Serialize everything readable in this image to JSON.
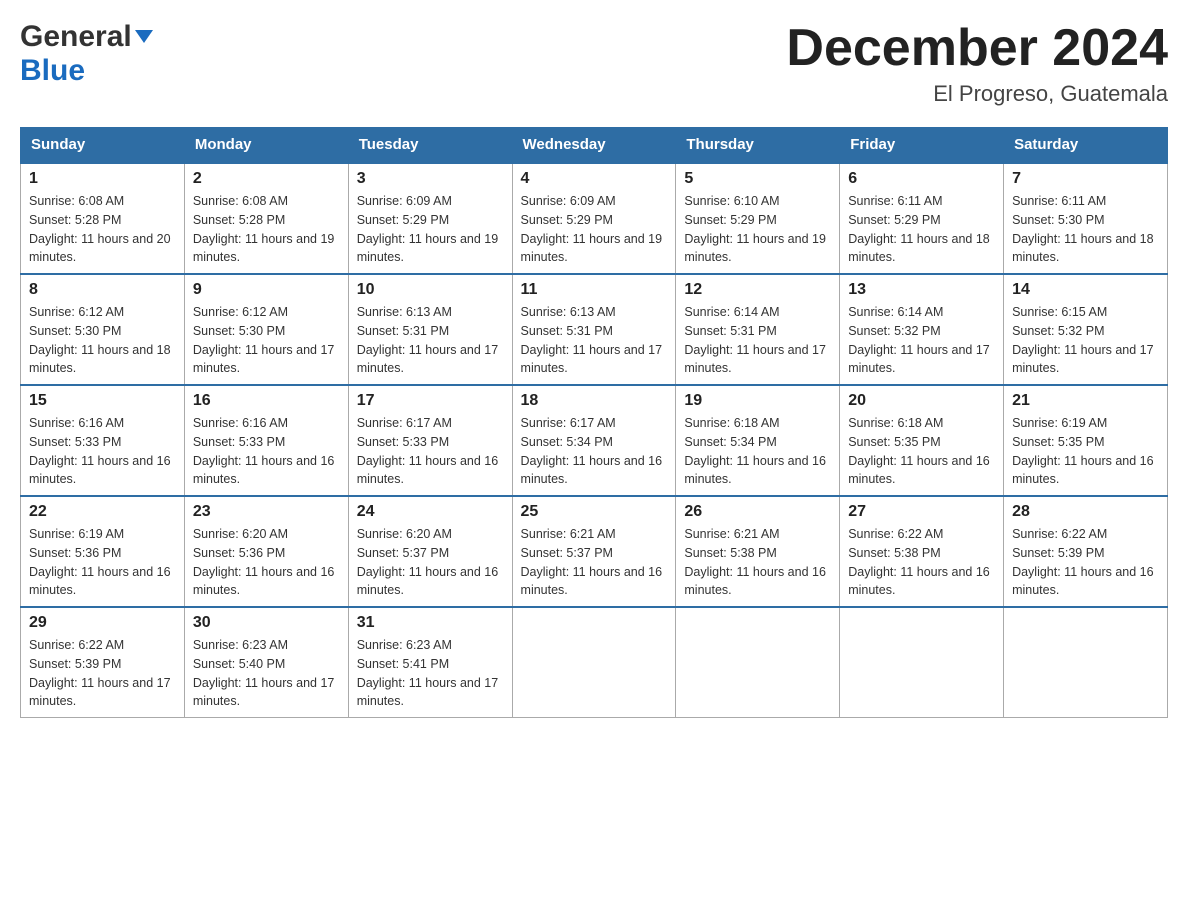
{
  "header": {
    "logo": {
      "general": "General",
      "blue": "Blue"
    },
    "month_title": "December 2024",
    "location": "El Progreso, Guatemala"
  },
  "calendar": {
    "days_of_week": [
      "Sunday",
      "Monday",
      "Tuesday",
      "Wednesday",
      "Thursday",
      "Friday",
      "Saturday"
    ],
    "weeks": [
      [
        {
          "day": "1",
          "sunrise": "6:08 AM",
          "sunset": "5:28 PM",
          "daylight": "11 hours and 20 minutes."
        },
        {
          "day": "2",
          "sunrise": "6:08 AM",
          "sunset": "5:28 PM",
          "daylight": "11 hours and 19 minutes."
        },
        {
          "day": "3",
          "sunrise": "6:09 AM",
          "sunset": "5:29 PM",
          "daylight": "11 hours and 19 minutes."
        },
        {
          "day": "4",
          "sunrise": "6:09 AM",
          "sunset": "5:29 PM",
          "daylight": "11 hours and 19 minutes."
        },
        {
          "day": "5",
          "sunrise": "6:10 AM",
          "sunset": "5:29 PM",
          "daylight": "11 hours and 19 minutes."
        },
        {
          "day": "6",
          "sunrise": "6:11 AM",
          "sunset": "5:29 PM",
          "daylight": "11 hours and 18 minutes."
        },
        {
          "day": "7",
          "sunrise": "6:11 AM",
          "sunset": "5:30 PM",
          "daylight": "11 hours and 18 minutes."
        }
      ],
      [
        {
          "day": "8",
          "sunrise": "6:12 AM",
          "sunset": "5:30 PM",
          "daylight": "11 hours and 18 minutes."
        },
        {
          "day": "9",
          "sunrise": "6:12 AM",
          "sunset": "5:30 PM",
          "daylight": "11 hours and 17 minutes."
        },
        {
          "day": "10",
          "sunrise": "6:13 AM",
          "sunset": "5:31 PM",
          "daylight": "11 hours and 17 minutes."
        },
        {
          "day": "11",
          "sunrise": "6:13 AM",
          "sunset": "5:31 PM",
          "daylight": "11 hours and 17 minutes."
        },
        {
          "day": "12",
          "sunrise": "6:14 AM",
          "sunset": "5:31 PM",
          "daylight": "11 hours and 17 minutes."
        },
        {
          "day": "13",
          "sunrise": "6:14 AM",
          "sunset": "5:32 PM",
          "daylight": "11 hours and 17 minutes."
        },
        {
          "day": "14",
          "sunrise": "6:15 AM",
          "sunset": "5:32 PM",
          "daylight": "11 hours and 17 minutes."
        }
      ],
      [
        {
          "day": "15",
          "sunrise": "6:16 AM",
          "sunset": "5:33 PM",
          "daylight": "11 hours and 16 minutes."
        },
        {
          "day": "16",
          "sunrise": "6:16 AM",
          "sunset": "5:33 PM",
          "daylight": "11 hours and 16 minutes."
        },
        {
          "day": "17",
          "sunrise": "6:17 AM",
          "sunset": "5:33 PM",
          "daylight": "11 hours and 16 minutes."
        },
        {
          "day": "18",
          "sunrise": "6:17 AM",
          "sunset": "5:34 PM",
          "daylight": "11 hours and 16 minutes."
        },
        {
          "day": "19",
          "sunrise": "6:18 AM",
          "sunset": "5:34 PM",
          "daylight": "11 hours and 16 minutes."
        },
        {
          "day": "20",
          "sunrise": "6:18 AM",
          "sunset": "5:35 PM",
          "daylight": "11 hours and 16 minutes."
        },
        {
          "day": "21",
          "sunrise": "6:19 AM",
          "sunset": "5:35 PM",
          "daylight": "11 hours and 16 minutes."
        }
      ],
      [
        {
          "day": "22",
          "sunrise": "6:19 AM",
          "sunset": "5:36 PM",
          "daylight": "11 hours and 16 minutes."
        },
        {
          "day": "23",
          "sunrise": "6:20 AM",
          "sunset": "5:36 PM",
          "daylight": "11 hours and 16 minutes."
        },
        {
          "day": "24",
          "sunrise": "6:20 AM",
          "sunset": "5:37 PM",
          "daylight": "11 hours and 16 minutes."
        },
        {
          "day": "25",
          "sunrise": "6:21 AM",
          "sunset": "5:37 PM",
          "daylight": "11 hours and 16 minutes."
        },
        {
          "day": "26",
          "sunrise": "6:21 AM",
          "sunset": "5:38 PM",
          "daylight": "11 hours and 16 minutes."
        },
        {
          "day": "27",
          "sunrise": "6:22 AM",
          "sunset": "5:38 PM",
          "daylight": "11 hours and 16 minutes."
        },
        {
          "day": "28",
          "sunrise": "6:22 AM",
          "sunset": "5:39 PM",
          "daylight": "11 hours and 16 minutes."
        }
      ],
      [
        {
          "day": "29",
          "sunrise": "6:22 AM",
          "sunset": "5:39 PM",
          "daylight": "11 hours and 17 minutes."
        },
        {
          "day": "30",
          "sunrise": "6:23 AM",
          "sunset": "5:40 PM",
          "daylight": "11 hours and 17 minutes."
        },
        {
          "day": "31",
          "sunrise": "6:23 AM",
          "sunset": "5:41 PM",
          "daylight": "11 hours and 17 minutes."
        },
        null,
        null,
        null,
        null
      ]
    ]
  }
}
